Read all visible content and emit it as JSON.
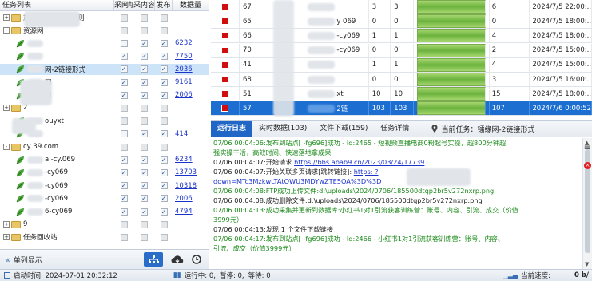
{
  "task_tree": {
    "headers": [
      "任务列表",
      "采网址",
      "采内容",
      "发布",
      "数据量"
    ],
    "rows": [
      {
        "name": "加盟站自动发布规则",
        "level": 0,
        "type": "folder",
        "expand": "+",
        "c1": false,
        "c2": false,
        "c3": false,
        "count": "",
        "enabled": false
      },
      {
        "name": "资源网",
        "level": 0,
        "type": "folder",
        "expand": "-",
        "c1": false,
        "c2": false,
        "c3": false,
        "count": "",
        "enabled": false
      },
      {
        "name": "",
        "level": 1,
        "type": "leaf",
        "c1": false,
        "c2": true,
        "c3": true,
        "count": "6232",
        "enabled": true
      },
      {
        "name": "",
        "level": 1,
        "type": "leaf",
        "c1": true,
        "c2": true,
        "c3": true,
        "count": "7750",
        "enabled": true
      },
      {
        "name": "网-2链接形式",
        "level": 1,
        "type": "leaf",
        "c1": true,
        "c2": true,
        "c3": true,
        "count": "2036",
        "enabled": true,
        "selected": true
      },
      {
        "name": "网",
        "level": 1,
        "type": "leaf",
        "c1": true,
        "c2": true,
        "c3": true,
        "count": "9161",
        "enabled": true
      },
      {
        "name": "网",
        "level": 1,
        "type": "leaf",
        "c1": true,
        "c2": true,
        "c3": true,
        "count": "2006",
        "enabled": true
      },
      {
        "name": "2",
        "level": 0,
        "type": "folder",
        "expand": "+",
        "c1": false,
        "c2": false,
        "c3": false,
        "count": "",
        "enabled": false
      },
      {
        "name": "ouyxt",
        "level": 1,
        "type": "leaf",
        "c1": false,
        "c2": false,
        "c3": false,
        "count": "",
        "enabled": false
      },
      {
        "name": "",
        "level": 1,
        "type": "leaf",
        "c1": false,
        "c2": true,
        "c3": true,
        "count": "414",
        "enabled": true
      },
      {
        "name": "cy 39.com",
        "level": 0,
        "type": "folder",
        "expand": "-",
        "c1": false,
        "c2": false,
        "c3": false,
        "count": "",
        "enabled": false
      },
      {
        "name": "ai-cy.069",
        "level": 1,
        "type": "leaf",
        "c1": true,
        "c2": true,
        "c3": true,
        "count": "6234",
        "enabled": true
      },
      {
        "name": "-cy069",
        "level": 1,
        "type": "leaf",
        "c1": true,
        "c2": true,
        "c3": true,
        "count": "13703",
        "enabled": true
      },
      {
        "name": "-cy069",
        "level": 1,
        "type": "leaf",
        "c1": true,
        "c2": true,
        "c3": true,
        "count": "10318",
        "enabled": true
      },
      {
        "name": "-cy069",
        "level": 1,
        "type": "leaf",
        "c1": true,
        "c2": true,
        "c3": true,
        "count": "2006",
        "enabled": true
      },
      {
        "name": "6-cy069",
        "level": 1,
        "type": "leaf",
        "c1": true,
        "c2": true,
        "c3": true,
        "count": "4794",
        "enabled": true
      },
      {
        "name": "9",
        "level": 0,
        "type": "folder",
        "expand": "+",
        "c1": false,
        "c2": false,
        "c3": false,
        "count": "",
        "enabled": false
      },
      {
        "name": "任务回收站",
        "level": 0,
        "type": "folder",
        "expand": "+",
        "c1": false,
        "c2": false,
        "c3": false,
        "count": "",
        "enabled": false
      }
    ]
  },
  "left_footer": {
    "label": "单列显示"
  },
  "task_table": {
    "rows": [
      {
        "id": "67",
        "name": "",
        "a": "3",
        "b": "3",
        "progress": 1.0,
        "c": "6",
        "time": "2024/7/5 22:00:..."
      },
      {
        "id": "65",
        "name": "y 069",
        "a": "0",
        "b": "0",
        "progress": 1.0,
        "c": "0",
        "time": "2024/7/5 18:00:..."
      },
      {
        "id": "66",
        "name": "-cy069",
        "a": "1",
        "b": "1",
        "progress": 1.0,
        "c": "4",
        "time": "2024/7/5 18:00:..."
      },
      {
        "id": "70",
        "name": "-cy069",
        "a": "0",
        "b": "0",
        "progress": 1.0,
        "c": "2",
        "time": "2024/7/5 15:00:..."
      },
      {
        "id": "41",
        "name": "",
        "a": "1",
        "b": "1",
        "progress": 1.0,
        "c": "4",
        "time": "2024/7/5 15:00:..."
      },
      {
        "id": "68",
        "name": "",
        "a": "0",
        "b": "0",
        "progress": 1.0,
        "c": "3",
        "time": "2024/7/5 16:00:..."
      },
      {
        "id": "51",
        "name": "xt",
        "a": "10",
        "b": "10",
        "progress": 1.0,
        "c": "15",
        "time": "2024/7/5 18:00:..."
      },
      {
        "id": "57",
        "name": "2链",
        "a": "103",
        "b": "103",
        "progress": 1.0,
        "c": "107",
        "time": "2024/7/6 0:00:52",
        "selected": true
      }
    ]
  },
  "tabs": [
    {
      "label": "运行日志",
      "active": true
    },
    {
      "label": "实时数据(103)"
    },
    {
      "label": "文件下载(159)"
    },
    {
      "label": "任务详情"
    }
  ],
  "current_task": "当前任务：镭缘网-2链接形式",
  "log_lines": [
    {
      "text": "07/06 00:04:06:发布到站点[   -fg696]成功 - Id:2465 - 短视频直播电商0粉起号实操，超800分钟超",
      "color": "g"
    },
    {
      "text": "强实操干活，高效时间、快速落地拿成果",
      "color": "g"
    },
    {
      "text": "07/06 00:04:07:开始请求 ",
      "color": "k",
      "link": "https://bbs.abab9.cn/2023/03/24/17739"
    },
    {
      "text": "07/06 00:04:07:开始关联多页请求[跳转链接]: ",
      "color": "k",
      "link": "https:                 ?"
    },
    {
      "text": "down=MTc3MzkwLTAtOWU3MDYwZTE5OA%3D%3D",
      "color": "b"
    },
    {
      "text": "07/06 00:04:08:FTP成功上传文件:d:\\uploads\\2024/0706/185500dtqp2br5v272nxrp.png",
      "color": "g"
    },
    {
      "text": "07/06 00:04:08:成功删除文件:d:\\uploads\\2024/0706/185500dtqp2br5v272nxrp.png",
      "color": "k"
    },
    {
      "text": "07/06 00:04:13:成功采集并更新到数据库:小红书1对1引流获客训练营：账号、内容、引流、成交（价值",
      "color": "g"
    },
    {
      "text": "3999元）",
      "color": "g"
    },
    {
      "text": "07/06 00:04:13:发现 1 个文件下载链接",
      "color": "k"
    },
    {
      "text": "07/06 00:04:17:发布到站点[   -fg696]成功 - Id:2466 - 小红书1对1引流获客训练营：账号、内容、",
      "color": "g"
    },
    {
      "text": "引流、成交（价值3999元）",
      "color": "g"
    }
  ],
  "status_bar": {
    "launch_time": "启动时间: 2024-07-01 20:32:12",
    "running": "运行中: 0,",
    "paused": "暂停: 0,",
    "waiting": "等待: 0",
    "speed_label": "当前速度:",
    "speed_value": "0 b/"
  },
  "colors": {
    "selected_row": "#1c6fd1",
    "tab_active": "#1f66c7",
    "log_green": "#1a8a1a",
    "status_red": "#d00e0e",
    "link_blue": "#1a33cc"
  }
}
